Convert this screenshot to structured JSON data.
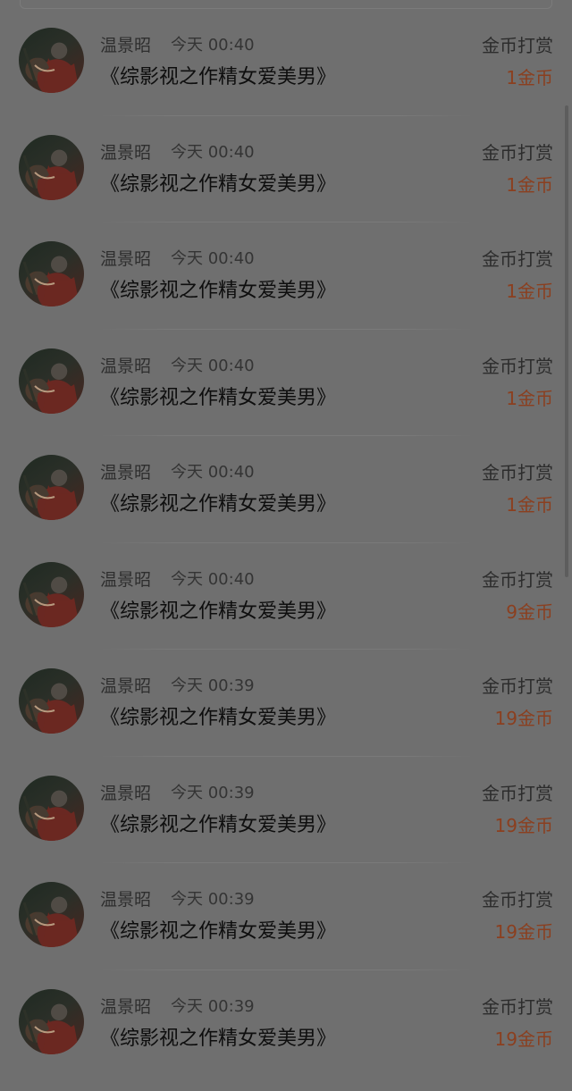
{
  "tips": [
    {
      "user": "温景昭",
      "time": "今天 00:40",
      "book": "《综影视之作精女爱美男》",
      "type": "金币打赏",
      "amount": "1金币"
    },
    {
      "user": "温景昭",
      "time": "今天 00:40",
      "book": "《综影视之作精女爱美男》",
      "type": "金币打赏",
      "amount": "1金币"
    },
    {
      "user": "温景昭",
      "time": "今天 00:40",
      "book": "《综影视之作精女爱美男》",
      "type": "金币打赏",
      "amount": "1金币"
    },
    {
      "user": "温景昭",
      "time": "今天 00:40",
      "book": "《综影视之作精女爱美男》",
      "type": "金币打赏",
      "amount": "1金币"
    },
    {
      "user": "温景昭",
      "time": "今天 00:40",
      "book": "《综影视之作精女爱美男》",
      "type": "金币打赏",
      "amount": "1金币"
    },
    {
      "user": "温景昭",
      "time": "今天 00:40",
      "book": "《综影视之作精女爱美男》",
      "type": "金币打赏",
      "amount": "9金币"
    },
    {
      "user": "温景昭",
      "time": "今天 00:39",
      "book": "《综影视之作精女爱美男》",
      "type": "金币打赏",
      "amount": "19金币"
    },
    {
      "user": "温景昭",
      "time": "今天 00:39",
      "book": "《综影视之作精女爱美男》",
      "type": "金币打赏",
      "amount": "19金币"
    },
    {
      "user": "温景昭",
      "time": "今天 00:39",
      "book": "《综影视之作精女爱美男》",
      "type": "金币打赏",
      "amount": "19金币"
    },
    {
      "user": "温景昭",
      "time": "今天 00:39",
      "book": "《综影视之作精女爱美男》",
      "type": "金币打赏",
      "amount": "19金币"
    }
  ],
  "colors": {
    "background": "#6f6f6f",
    "amount": "#8b3f1f",
    "title_text": "#0e0e0e",
    "secondary_text": "#2e2e2e"
  },
  "icons": {
    "avatar": "user-avatar-photo"
  }
}
